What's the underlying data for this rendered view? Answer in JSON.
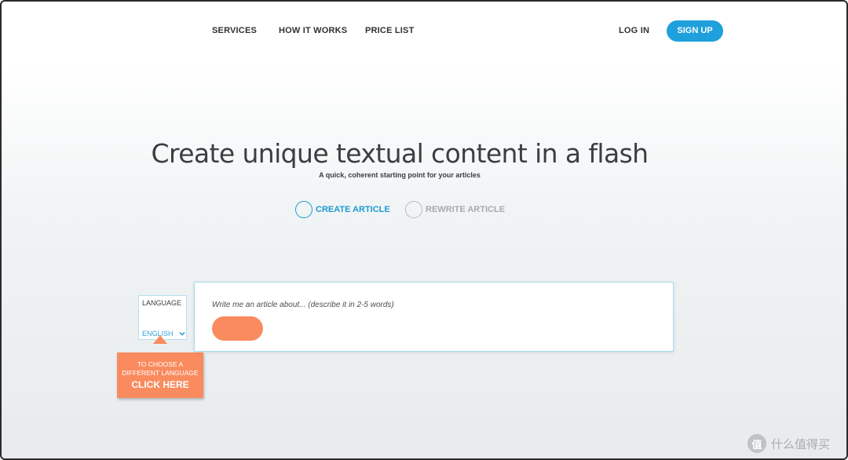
{
  "nav": {
    "links": [
      "SERVICES",
      "HOW IT WORKS",
      "PRICE LIST"
    ],
    "login": "LOG IN",
    "signup": "SIGN UP"
  },
  "hero": {
    "title": "Create unique textual content in a flash",
    "subtitle": "A quick, coherent starting point for your articles"
  },
  "modes": {
    "create": "CREATE ARTICLE",
    "rewrite": "REWRITE ARTICLE",
    "selected": "CREATE ARTICLE"
  },
  "language": {
    "label": "LANGUAGE",
    "value": "ENGLISH"
  },
  "tooltip": {
    "line1": "TO CHOOSE A",
    "line2": "DIFFERENT LANGUAGE",
    "cta": "CLICK HERE"
  },
  "article": {
    "placeholder": "Write me an article about... (describe it in 2-5 words)",
    "value": "",
    "submit_label": ""
  },
  "watermark": {
    "logo": "值",
    "text": "什么值得买"
  },
  "colors": {
    "accent": "#1ea0dc",
    "orange": "#f98b5f",
    "text": "#2f3235"
  }
}
